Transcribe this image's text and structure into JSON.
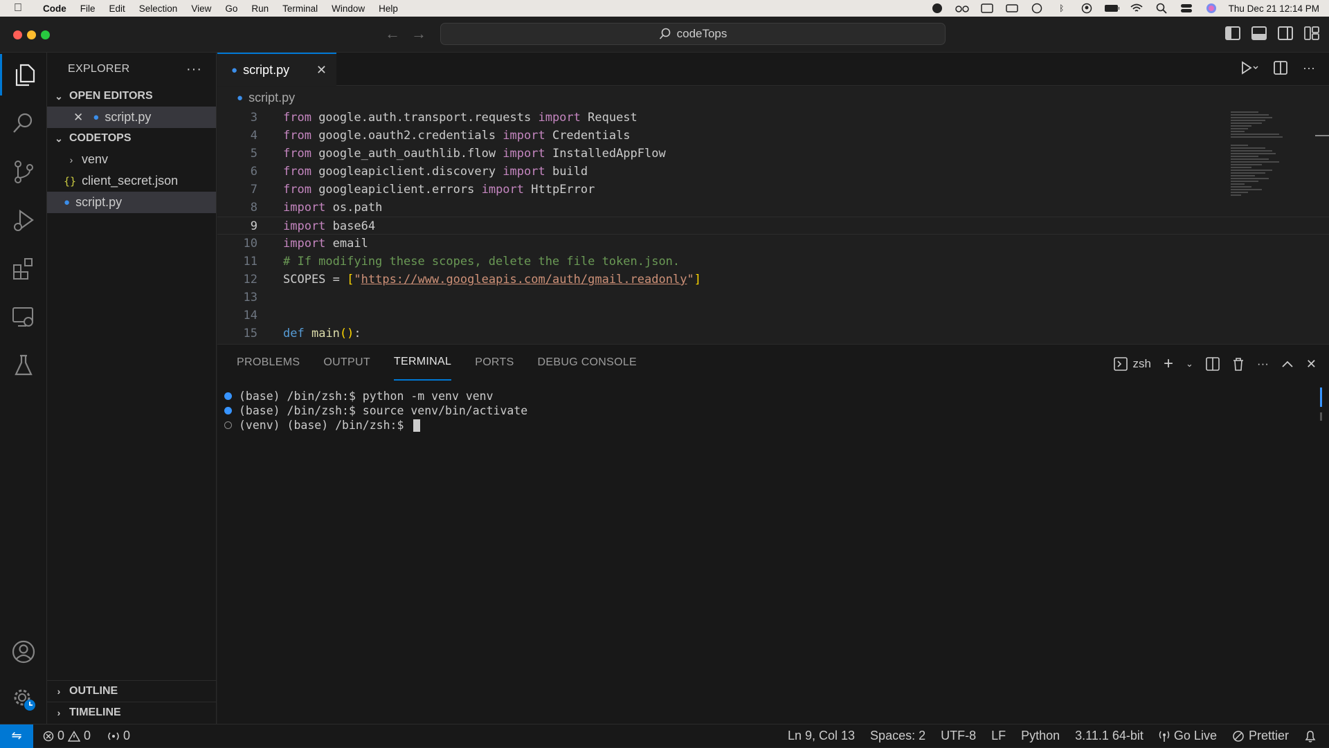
{
  "menubar": {
    "app": "Code",
    "items": [
      "File",
      "Edit",
      "Selection",
      "View",
      "Go",
      "Run",
      "Terminal",
      "Window",
      "Help"
    ],
    "clock": "Thu Dec 21  12:14 PM"
  },
  "titlebar": {
    "search": "codeTops"
  },
  "sidebar": {
    "title": "EXPLORER",
    "open_editors_label": "OPEN EDITORS",
    "open_editor_file": "script.py",
    "folder_label": "CODETOPS",
    "items": [
      {
        "label": "venv",
        "type": "folder"
      },
      {
        "label": "client_secret.json",
        "type": "json"
      },
      {
        "label": "script.py",
        "type": "python"
      }
    ],
    "outline_label": "OUTLINE",
    "timeline_label": "TIMELINE"
  },
  "editor": {
    "tab": "script.py",
    "breadcrumb": "script.py",
    "current_line": 9,
    "lines": [
      {
        "n": "3",
        "parts": [
          [
            "kw",
            "from"
          ],
          [
            "t",
            " google.auth.transport.requests "
          ],
          [
            "kw",
            "import"
          ],
          [
            "t",
            " Request"
          ]
        ]
      },
      {
        "n": "4",
        "parts": [
          [
            "kw",
            "from"
          ],
          [
            "t",
            " google.oauth2.credentials "
          ],
          [
            "kw",
            "import"
          ],
          [
            "t",
            " Credentials"
          ]
        ]
      },
      {
        "n": "5",
        "parts": [
          [
            "kw",
            "from"
          ],
          [
            "t",
            " google_auth_oauthlib.flow "
          ],
          [
            "kw",
            "import"
          ],
          [
            "t",
            " InstalledAppFlow"
          ]
        ]
      },
      {
        "n": "6",
        "parts": [
          [
            "kw",
            "from"
          ],
          [
            "t",
            " googleapiclient.discovery "
          ],
          [
            "kw",
            "import"
          ],
          [
            "t",
            " build"
          ]
        ]
      },
      {
        "n": "7",
        "parts": [
          [
            "kw",
            "from"
          ],
          [
            "t",
            " googleapiclient.errors "
          ],
          [
            "kw",
            "import"
          ],
          [
            "t",
            " HttpError"
          ]
        ]
      },
      {
        "n": "8",
        "parts": [
          [
            "kw",
            "import"
          ],
          [
            "t",
            " os.path"
          ]
        ]
      },
      {
        "n": "9",
        "parts": [
          [
            "kw",
            "import"
          ],
          [
            "t",
            " base64"
          ]
        ]
      },
      {
        "n": "10",
        "parts": [
          [
            "kw",
            "import"
          ],
          [
            "t",
            " email"
          ]
        ]
      },
      {
        "n": "11",
        "parts": [
          [
            "cm",
            "# If modifying these scopes, delete the file token.json."
          ]
        ]
      },
      {
        "n": "12",
        "parts": [
          [
            "t",
            "SCOPES = "
          ],
          [
            "br",
            "["
          ],
          [
            "st",
            "\""
          ],
          [
            "url",
            "https://www.googleapis.com/auth/gmail.readonly"
          ],
          [
            "st",
            "\""
          ],
          [
            "br",
            "]"
          ]
        ]
      },
      {
        "n": "13",
        "parts": []
      },
      {
        "n": "14",
        "parts": []
      },
      {
        "n": "15",
        "parts": [
          [
            "kwb",
            "def"
          ],
          [
            "t",
            " "
          ],
          [
            "fn",
            "main"
          ],
          [
            "br",
            "()"
          ],
          [
            "t",
            ":"
          ]
        ]
      }
    ]
  },
  "panel": {
    "tabs": [
      "PROBLEMS",
      "OUTPUT",
      "TERMINAL",
      "PORTS",
      "DEBUG CONSOLE"
    ],
    "active_tab": "TERMINAL",
    "shell": "zsh",
    "terminal_lines": [
      {
        "marker": "filled",
        "text": "(base) /bin/zsh:$ python -m venv venv"
      },
      {
        "marker": "filled",
        "text": "(base) /bin/zsh:$ source venv/bin/activate"
      },
      {
        "marker": "hollow",
        "text": "(venv) (base) /bin/zsh:$ "
      }
    ]
  },
  "statusbar": {
    "errors": "0",
    "warnings": "0",
    "ports": "0",
    "position": "Ln 9, Col 13",
    "spaces": "Spaces: 2",
    "encoding": "UTF-8",
    "eol": "LF",
    "language": "Python",
    "interpreter": "3.11.1 64-bit",
    "golive": "Go Live",
    "prettier": "Prettier"
  },
  "colors": {
    "accent": "#0078d4",
    "python_icon": "#3b8eea",
    "json_icon": "#cbcb41"
  }
}
